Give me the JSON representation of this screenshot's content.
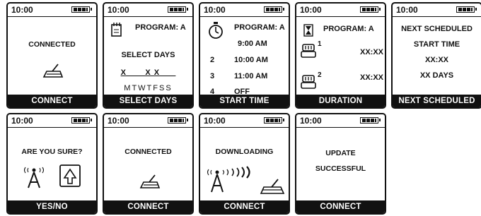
{
  "status": {
    "time": "10:00"
  },
  "screens": {
    "connected": {
      "message": "CONNECTED",
      "footer": "CONNECT"
    },
    "select_days": {
      "program": "PROGRAM: A",
      "heading": "SELECT DAYS",
      "pattern": "X _ _ X X _ _",
      "days": "MTWTFSS",
      "footer": "SELECT DAYS"
    },
    "start_time": {
      "program": "PROGRAM: A",
      "times": [
        {
          "num": "",
          "time": "9:00 AM"
        },
        {
          "num": "2",
          "time": "10:00 AM"
        },
        {
          "num": "3",
          "time": "11:00 AM"
        },
        {
          "num": "4",
          "time": "OFF"
        }
      ],
      "footer": "START TIME"
    },
    "duration": {
      "program": "PROGRAM: A",
      "zones": [
        {
          "num": "1",
          "value": "XX:XX"
        },
        {
          "num": "2",
          "value": "XX:XX"
        }
      ],
      "footer": "DURATION"
    },
    "next_scheduled": {
      "lines": [
        "NEXT SCHEDULED",
        "START TIME",
        "XX:XX",
        "XX DAYS"
      ],
      "footer": "NEXT SCHEDULED"
    },
    "are_you_sure": {
      "message": "ARE YOU SURE?",
      "footer": "YES/NO"
    },
    "connected2": {
      "message": "CONNECTED",
      "footer": "CONNECT"
    },
    "downloading": {
      "message": "DOWNLOADING",
      "footer": "CONNECT"
    },
    "update": {
      "line1": "UPDATE",
      "line2": "SUCCESSFUL",
      "footer": "CONNECT"
    }
  }
}
